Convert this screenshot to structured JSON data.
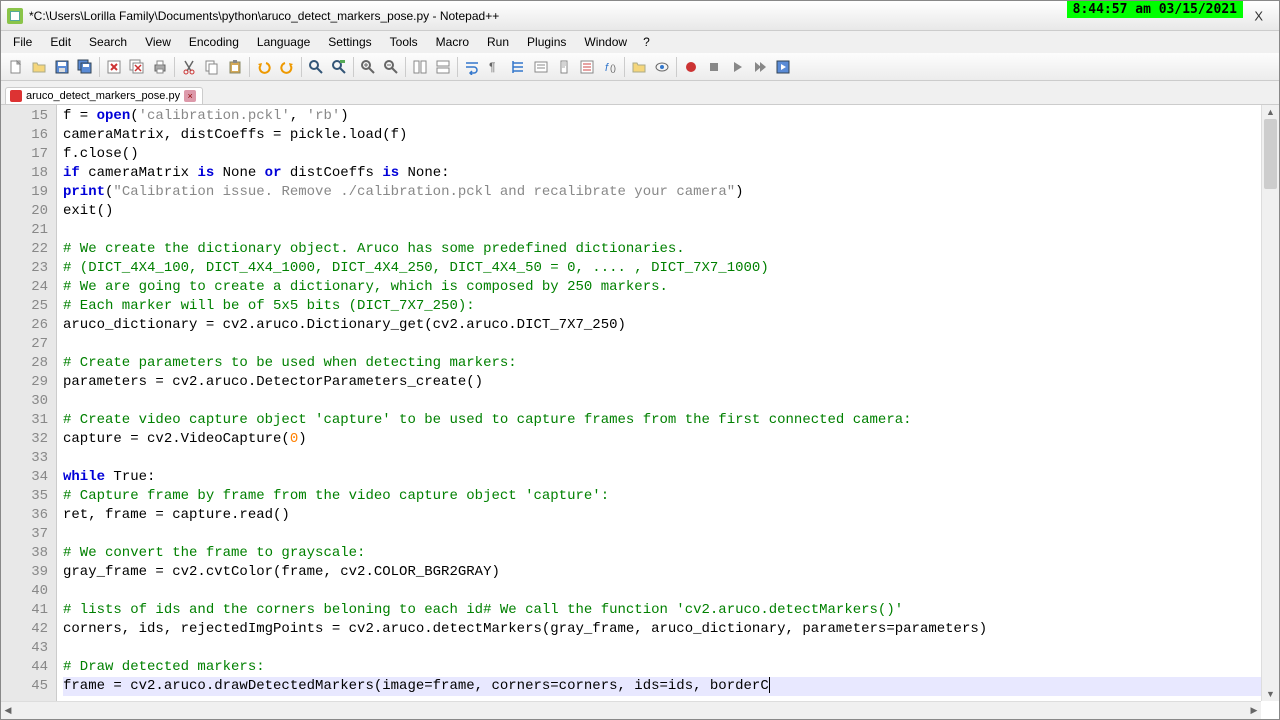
{
  "titlebar": {
    "text": "*C:\\Users\\Lorilla Family\\Documents\\python\\aruco_detect_markers_pose.py - Notepad++",
    "timestamp": "8:44:57 am 03/15/2021",
    "close": "X"
  },
  "menu": {
    "file": "File",
    "edit": "Edit",
    "search": "Search",
    "view": "View",
    "encoding": "Encoding",
    "language": "Language",
    "settings": "Settings",
    "tools": "Tools",
    "macro": "Macro",
    "run": "Run",
    "plugins": "Plugins",
    "window": "Window",
    "help": "?"
  },
  "tab": {
    "name": "aruco_detect_markers_pose.py",
    "close": "×"
  },
  "code": {
    "first_line": 15,
    "lines": [
      {
        "n": 15,
        "seg": [
          [
            "p",
            "f = "
          ],
          [
            "kw",
            "open"
          ],
          [
            "p",
            "("
          ],
          [
            "str",
            "'calibration.pckl'"
          ],
          [
            "p",
            ", "
          ],
          [
            "str",
            "'rb'"
          ],
          [
            "p",
            ")"
          ]
        ]
      },
      {
        "n": 16,
        "seg": [
          [
            "p",
            "cameraMatrix, distCoeffs = pickle.load(f)"
          ]
        ]
      },
      {
        "n": 17,
        "seg": [
          [
            "p",
            "f.close()"
          ]
        ]
      },
      {
        "n": 18,
        "seg": [
          [
            "kw",
            "if"
          ],
          [
            "p",
            " cameraMatrix "
          ],
          [
            "kw",
            "is"
          ],
          [
            "p",
            " None "
          ],
          [
            "kw",
            "or"
          ],
          [
            "p",
            " distCoeffs "
          ],
          [
            "kw",
            "is"
          ],
          [
            "p",
            " None:"
          ]
        ]
      },
      {
        "n": 19,
        "seg": [
          [
            "kw",
            "print"
          ],
          [
            "p",
            "("
          ],
          [
            "str",
            "\"Calibration issue. Remove ./calibration.pckl and recalibrate your camera\""
          ],
          [
            "p",
            ")"
          ]
        ]
      },
      {
        "n": 20,
        "seg": [
          [
            "p",
            "exit()"
          ]
        ]
      },
      {
        "n": 21,
        "seg": []
      },
      {
        "n": 22,
        "seg": [
          [
            "com",
            "# We create the dictionary object. Aruco has some predefined dictionaries."
          ]
        ]
      },
      {
        "n": 23,
        "seg": [
          [
            "com",
            "# (DICT_4X4_100, DICT_4X4_1000, DICT_4X4_250, DICT_4X4_50 = 0, .... , DICT_7X7_1000)"
          ]
        ]
      },
      {
        "n": 24,
        "seg": [
          [
            "com",
            "# We are going to create a dictionary, which is composed by 250 markers."
          ]
        ]
      },
      {
        "n": 25,
        "seg": [
          [
            "com",
            "# Each marker will be of 5x5 bits (DICT_7X7_250):"
          ]
        ]
      },
      {
        "n": 26,
        "seg": [
          [
            "p",
            "aruco_dictionary = cv2.aruco.Dictionary_get(cv2.aruco.DICT_7X7_250)"
          ]
        ]
      },
      {
        "n": 27,
        "seg": []
      },
      {
        "n": 28,
        "seg": [
          [
            "com",
            "# Create parameters to be used when detecting markers:"
          ]
        ]
      },
      {
        "n": 29,
        "seg": [
          [
            "p",
            "parameters = cv2.aruco.DetectorParameters_create()"
          ]
        ]
      },
      {
        "n": 30,
        "seg": []
      },
      {
        "n": 31,
        "seg": [
          [
            "com",
            "# Create video capture object 'capture' to be used to capture frames from the first connected camera:"
          ]
        ]
      },
      {
        "n": 32,
        "seg": [
          [
            "p",
            "capture = cv2.VideoCapture("
          ],
          [
            "num",
            "0"
          ],
          [
            "p",
            ")"
          ]
        ]
      },
      {
        "n": 33,
        "seg": []
      },
      {
        "n": 34,
        "seg": [
          [
            "kw",
            "while"
          ],
          [
            "p",
            " True:"
          ]
        ]
      },
      {
        "n": 35,
        "seg": [
          [
            "com",
            "# Capture frame by frame from the video capture object 'capture':"
          ]
        ]
      },
      {
        "n": 36,
        "seg": [
          [
            "p",
            "ret, frame = capture.read()"
          ]
        ]
      },
      {
        "n": 37,
        "seg": []
      },
      {
        "n": 38,
        "seg": [
          [
            "com",
            "# We convert the frame to grayscale:"
          ]
        ]
      },
      {
        "n": 39,
        "seg": [
          [
            "p",
            "gray_frame = cv2.cvtColor(frame, cv2.COLOR_BGR2GRAY)"
          ]
        ]
      },
      {
        "n": 40,
        "seg": []
      },
      {
        "n": 41,
        "seg": [
          [
            "com",
            "# lists of ids and the corners beloning to each id# We call the function 'cv2.aruco.detectMarkers()'"
          ]
        ]
      },
      {
        "n": 42,
        "seg": [
          [
            "p",
            "corners, ids, rejectedImgPoints = cv2.aruco.detectMarkers(gray_frame, aruco_dictionary, parameters=parameters)"
          ]
        ]
      },
      {
        "n": 43,
        "seg": []
      },
      {
        "n": 44,
        "seg": [
          [
            "com",
            "# Draw detected markers:"
          ]
        ]
      },
      {
        "n": 45,
        "current": true,
        "seg": [
          [
            "p",
            "frame = cv2.aruco.drawDetectedMarkers(image=frame, corners=corners, ids=ids, borderC"
          ]
        ]
      }
    ]
  }
}
